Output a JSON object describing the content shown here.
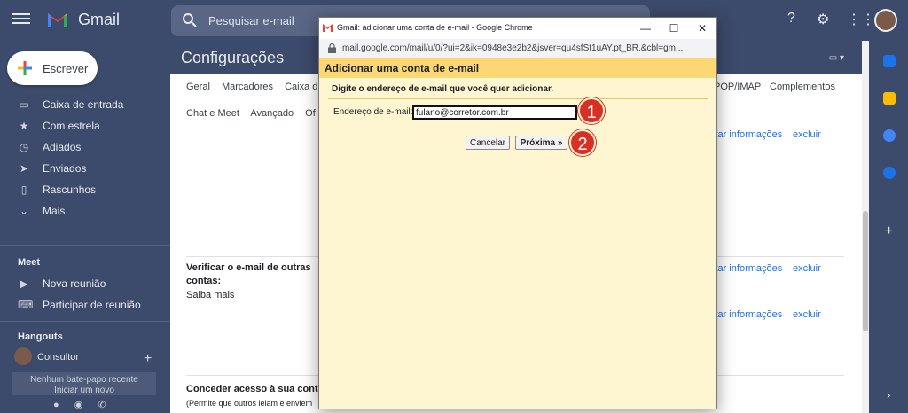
{
  "app": {
    "name": "Gmail"
  },
  "search": {
    "placeholder": "Pesquisar e-mail"
  },
  "compose": {
    "label": "Escrever"
  },
  "nav": {
    "items": [
      {
        "label": "Caixa de entrada",
        "icon": "inbox-icon"
      },
      {
        "label": "Com estrela",
        "icon": "star-icon"
      },
      {
        "label": "Adiados",
        "icon": "clock-icon"
      },
      {
        "label": "Enviados",
        "icon": "send-icon"
      },
      {
        "label": "Rascunhos",
        "icon": "draft-icon"
      },
      {
        "label": "Mais",
        "icon": "chevron-down-icon"
      }
    ]
  },
  "meet": {
    "title": "Meet",
    "items": [
      {
        "label": "Nova reunião",
        "icon": "video-icon"
      },
      {
        "label": "Participar de reunião",
        "icon": "keyboard-icon"
      }
    ]
  },
  "hangouts": {
    "title": "Hangouts",
    "user": "Consultor",
    "no_chat": "Nenhum bate-papo recente",
    "no_chat_2": "Iniciar um novo"
  },
  "settings": {
    "title": "Configurações",
    "tabs_row1": [
      "Geral",
      "Marcadores",
      "Caixa d"
    ],
    "tabs_row1_right": [
      "POP/IMAP",
      "Complementos"
    ],
    "tabs_row2": [
      "Chat e Meet",
      "Avançado",
      "Of"
    ],
    "row_links": {
      "edit": "itar informações",
      "delete": "excluir"
    },
    "check_mail_label": "Verificar o e-mail de outras",
    "check_mail_label_2": "contas:",
    "learn_more": "Saiba mais",
    "grant_access_label": "Conceder acesso à sua conta:",
    "grant_access_sub": "(Permite que outros leiam e enviem"
  },
  "popup": {
    "window_title": "Gmail: adicionar uma conta de e-mail - Google Chrome",
    "url": "mail.google.com/mail/u/0/?ui=2&ik=0948e3e2b2&jsver=qu4sfSt1uAY.pt_BR.&cbl=gm...",
    "heading": "Adicionar uma conta de e-mail",
    "instruction": "Digite o endereço de e-mail que você quer adicionar.",
    "field_label": "Endereço de e-mail:",
    "email_value": "fulano@corretor.com.br",
    "cancel": "Cancelar",
    "next": "Próxima »",
    "step1": "1",
    "step2": "2"
  },
  "colors": {
    "theme_bg": "#3c4a6b",
    "popup_bg": "#fdf6d0",
    "popup_header": "#fcd774",
    "badge": "#d93025",
    "link": "#1a73e8"
  }
}
